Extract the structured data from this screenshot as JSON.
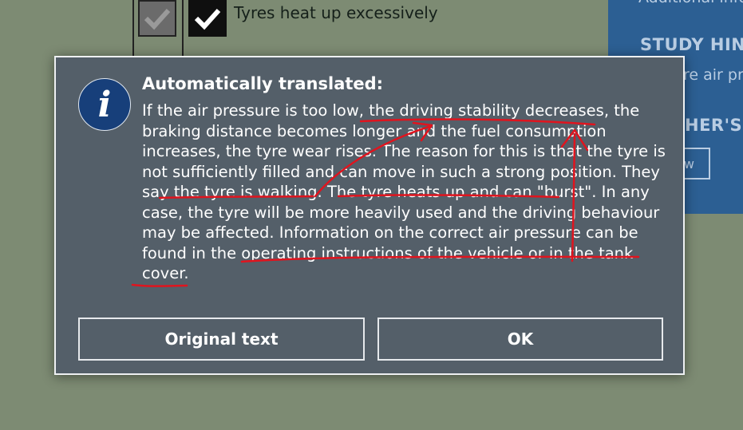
{
  "background": {
    "answer_text": "Tyres heat up excessively",
    "side_panel": {
      "partial_top": "Additional info",
      "heading": "STUDY HINT",
      "body_partial": "re air pr",
      "teacher_heading": "HER'S",
      "button_partial": "w"
    }
  },
  "dialog": {
    "title": "Automatically translated:",
    "body_lines": [
      "If the air pressure is too low, the driving stability decreases, the",
      "braking distance becomes longer and the fuel consumption",
      "increases, the tyre wear rises. The reason for this is that the tyre is",
      "not sufficiently filled and can move in such a strong position. They",
      "say the tyre is walking. The tyre heats up and can \"burst\". In any",
      "case, the tyre will be more heavily used and the driving behaviour",
      "may be affected. Information on the correct air pressure can be",
      "found in the operating instructions of the vehicle or in the tank",
      "cover."
    ],
    "original_text_button": "Original text",
    "ok_button": "OK",
    "icon": "info-icon"
  },
  "colors": {
    "page_bg": "#7d8b73",
    "dialog_bg": "#545f69",
    "side_panel_bg": "#2c5f93",
    "info_icon_bg": "#173f7a",
    "annotation_red": "#e0141e"
  }
}
